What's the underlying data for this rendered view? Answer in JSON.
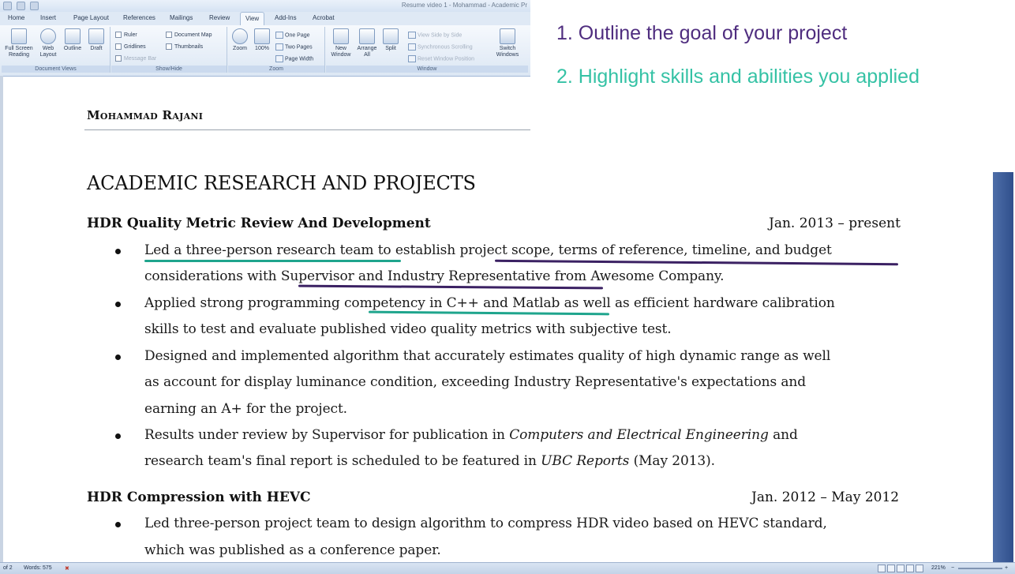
{
  "word": {
    "window_title": "Resume video 1 - Mohammad - Academic Pr",
    "tabs": [
      "Home",
      "Insert",
      "Page Layout",
      "References",
      "Mailings",
      "Review",
      "View",
      "Add-Ins",
      "Acrobat"
    ],
    "active_tab": "View",
    "ribbon": {
      "document_views": {
        "label": "Document Views",
        "buttons": [
          "Full Screen Reading",
          "Web Layout",
          "Outline",
          "Draft"
        ]
      },
      "show_hide": {
        "label": "Show/Hide",
        "options": [
          "Ruler",
          "Gridlines",
          "Message Bar",
          "Document Map",
          "Thumbnails"
        ]
      },
      "zoom": {
        "label": "Zoom",
        "buttons": [
          "Zoom",
          "100%"
        ],
        "small": [
          "One Page",
          "Two Pages",
          "Page Width"
        ]
      },
      "window": {
        "label": "Window",
        "buttons": [
          "New Window",
          "Arrange All",
          "Split"
        ],
        "small": [
          "View Side by Side",
          "Synchronous Scrolling",
          "Reset Window Position"
        ],
        "switch": "Switch Windows"
      }
    },
    "status": {
      "page": "of 2",
      "words": "Words: 575",
      "zoom": "221%"
    }
  },
  "annotations": [
    "1. Outline the goal of your project",
    "2. Highlight skills and abilities you applied"
  ],
  "colors": {
    "teal": "#1fa58d",
    "purple": "#3b2163",
    "note_purple": "#4f2d7f",
    "note_teal": "#35c2a5"
  },
  "document": {
    "author": "Mohammad Rajani",
    "section": "ACADEMIC RESEARCH AND PROJECTS",
    "projects": [
      {
        "title": "HDR Quality Metric Review And Development",
        "date": "Jan. 2013 – present",
        "lines": [
          {
            "pre": "",
            "u1": "Led a three-person research team",
            "mid": " to establish ",
            "u2": "project scope, terms of reference, timeline, and budget"
          },
          {
            "pre": "considerations with ",
            "u1": "Supervisor and Industry Representative",
            "post": " from Awesome Company."
          },
          {
            "pre": "Applied strong programming ",
            "u1": "competency in C++ and Matlab",
            "post": " as well as efficient hardware calibration"
          },
          {
            "text": "skills to test and evaluate published video quality metrics with subjective test."
          },
          {
            "text": "Designed and implemented algorithm that accurately estimates quality of high dynamic range as well"
          },
          {
            "text": "as account for display luminance condition, exceeding Industry Representative's expectations and"
          },
          {
            "text": "earning an A+ for the project."
          },
          {
            "pre": "Results under review by Supervisor for publication in ",
            "em": "Computers and Electrical Engineering",
            "post": " and"
          },
          {
            "pre": "research team's final report is scheduled to be featured in ",
            "em": "UBC Reports",
            "post": " (May 2013)."
          }
        ]
      },
      {
        "title": "HDR Compression with HEVC",
        "date": "Jan. 2012 – May 2012",
        "lines": [
          {
            "text": "Led three-person project team to design algorithm to compress HDR video based on HEVC standard,"
          },
          {
            "text": "which was published as a conference paper."
          }
        ]
      }
    ]
  }
}
